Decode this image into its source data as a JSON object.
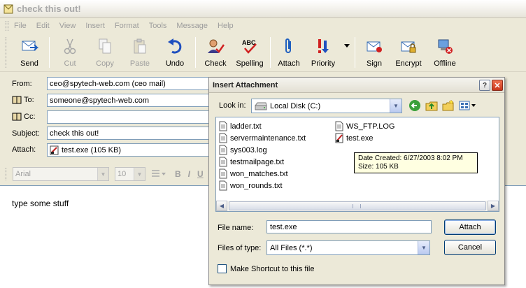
{
  "window": {
    "title": "check this out!"
  },
  "menu": [
    "File",
    "Edit",
    "View",
    "Insert",
    "Format",
    "Tools",
    "Message",
    "Help"
  ],
  "toolbar": {
    "send": "Send",
    "cut": "Cut",
    "copy": "Copy",
    "paste": "Paste",
    "undo": "Undo",
    "check": "Check",
    "spelling": "Spelling",
    "attach": "Attach",
    "priority": "Priority",
    "sign": "Sign",
    "encrypt": "Encrypt",
    "offline": "Offline"
  },
  "header": {
    "from_label": "From:",
    "from_value": "ceo@spytech-web.com    (ceo mail)",
    "to_label": "To:",
    "to_value": "someone@spytech-web.com",
    "cc_label": "Cc:",
    "cc_value": "",
    "subject_label": "Subject:",
    "subject_value": "check this out!",
    "attach_label": "Attach:",
    "attach_value": "test.exe (105 KB)"
  },
  "format": {
    "font": "Arial",
    "size": "10",
    "bold": "B",
    "italic": "I",
    "underline": "U"
  },
  "body": {
    "text": "type some stuff"
  },
  "dialog": {
    "title": "Insert Attachment",
    "help": "?",
    "close": "✕",
    "lookin_label": "Look in:",
    "lookin_value": "Local Disk (C:)",
    "files_col1": [
      "ladder.txt",
      "servermaintenance.txt",
      "sys003.log",
      "testmailpage.txt",
      "won_matches.txt",
      "won_rounds.txt"
    ],
    "files_col2": [
      "WS_FTP.LOG",
      "test.exe"
    ],
    "tooltip_line1": "Date Created: 6/27/2003 8:02 PM",
    "tooltip_line2": "Size: 105 KB",
    "filename_label": "File name:",
    "filename_value": "test.exe",
    "filetype_label": "Files of type:",
    "filetype_value": "All Files (*.*)",
    "attach_button": "Attach",
    "cancel_button": "Cancel",
    "shortcut_label": "Make Shortcut to this file"
  }
}
